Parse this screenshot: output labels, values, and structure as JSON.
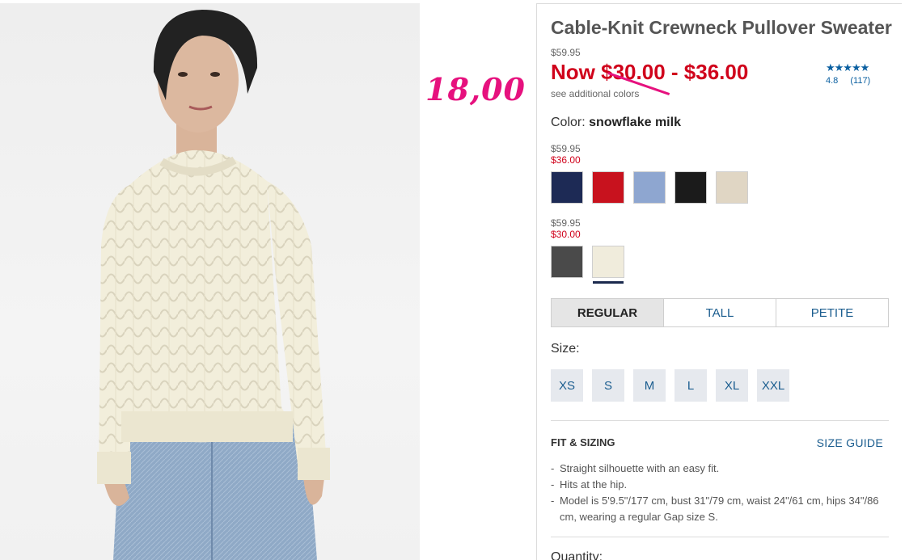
{
  "product": {
    "title": "Cable-Knit Crewneck Pullover Sweater",
    "original_price": "$59.95",
    "now_price_prefix": "Now",
    "now_price_low": "$30.00",
    "now_price_sep": "-",
    "now_price_high": "$36.00",
    "see_colors": "see additional colors"
  },
  "rating": {
    "stars": "★★★★★",
    "value": "4.8",
    "count": "(117)",
    "color": "#0a5fa0"
  },
  "annotation": {
    "text": "18,00",
    "color": "#e6117e"
  },
  "color_selector": {
    "label": "Color:",
    "selected_name": "snowflake milk",
    "groups": [
      {
        "orig_price": "$59.95",
        "sale_price": "$36.00",
        "swatches": [
          {
            "name": "navy",
            "hex": "#1d2a55"
          },
          {
            "name": "red",
            "hex": "#c8121e"
          },
          {
            "name": "blue marl",
            "hex": "#8ea6d0"
          },
          {
            "name": "black",
            "hex": "#1b1b1b"
          },
          {
            "name": "oatmeal",
            "hex": "#e0d6c4"
          }
        ]
      },
      {
        "orig_price": "$59.95",
        "sale_price": "$30.00",
        "swatches": [
          {
            "name": "charcoal marl",
            "hex": "#4a4a4a"
          },
          {
            "name": "snowflake milk",
            "hex": "#f0ecdc",
            "selected": true
          }
        ]
      }
    ]
  },
  "fit_tabs": [
    {
      "label": "REGULAR",
      "active": true
    },
    {
      "label": "TALL",
      "active": false
    },
    {
      "label": "PETITE",
      "active": false
    }
  ],
  "size": {
    "label": "Size:",
    "options": [
      "XS",
      "S",
      "M",
      "L",
      "XL",
      "XXL"
    ]
  },
  "fit_sizing": {
    "heading": "FIT & SIZING",
    "guide_link": "SIZE GUIDE",
    "bullets": [
      "Straight silhouette with an easy fit.",
      "Hits at the hip.",
      "Model is 5'9.5\"/177 cm, bust 31\"/79 cm, waist 24\"/61 cm, hips 34\"/86 cm, wearing a regular Gap size S."
    ]
  },
  "quantity_label": "Quantity:",
  "colors": {
    "accent_blue": "#1b5d8f",
    "sale_red": "#d0021b",
    "sweater": "#f2eedb",
    "jeans": "#8fa9c6"
  }
}
